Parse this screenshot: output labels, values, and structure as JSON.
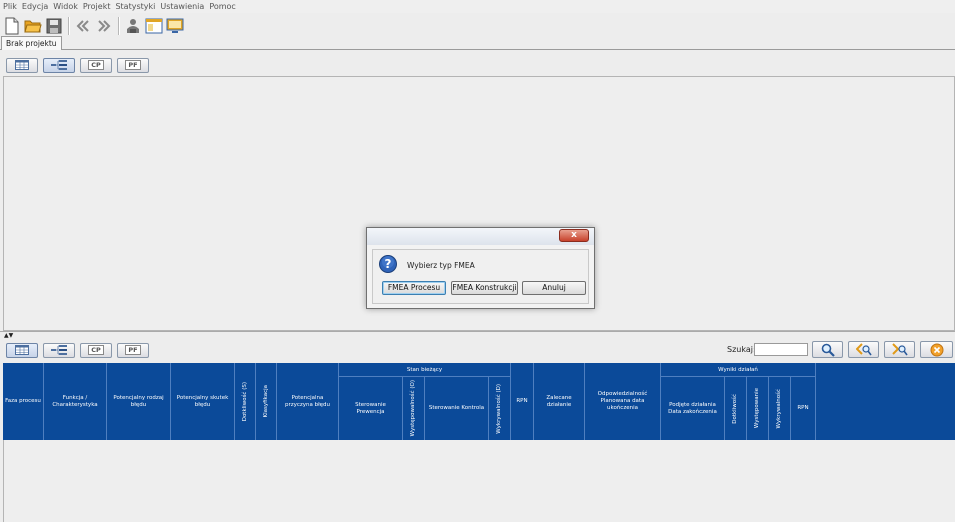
{
  "menu": [
    "Plik",
    "Edycja",
    "Widok",
    "Projekt",
    "Statystyki",
    "Ustawienia",
    "Pomoc"
  ],
  "toolbar": {
    "icons": [
      "new-file-icon",
      "open-folder-icon",
      "save-icon",
      "back-icon",
      "forward-icon",
      "users-icon",
      "window-icon",
      "monitor-icon"
    ]
  },
  "tab": {
    "label": "Brak projektu"
  },
  "view_buttons": {
    "cp": "CP",
    "pf": "PF"
  },
  "search": {
    "label": "Szukaj:",
    "value": ""
  },
  "grid": {
    "columns": {
      "faza": "Faza procesu",
      "funkcja": "Funkcja / Charakterystyka",
      "rodzaj": "Potencjalny rodzaj błędu",
      "skutek": "Potencjalny skutek błędu",
      "dotkliwosc": "Dotkliwość (S)",
      "klasyfikacja": "Klasyfikacja",
      "przyczyna": "Potencjalna przyczyna błędu",
      "stan_group": "Stan bieżący",
      "sterowanie_prewencja": "Sterowanie Prewencja",
      "wystepowalnosc": "Występowalność (O)",
      "sterowanie_kontrola": "Sterowanie Kontrola",
      "wykrywalnosc": "Wykrywalność (D)",
      "rpn": "RPN",
      "zalecane": "Zalecane działanie",
      "odpowiedzialnosc": "Odpowiedzialność Planowana data ukończenia",
      "wyniki_group": "Wyniki działań",
      "podjete": "Podjęte działania Data zakończenia",
      "w_dotkliwosc": "Dotkliwość",
      "w_wystepowanie": "Występowanie",
      "w_wykrywalnosc": "Wykrywalność",
      "w_rpn": "RPN"
    }
  },
  "dialog": {
    "close": "x",
    "message": "Wybierz typ FMEA",
    "buttons": {
      "procesu": "FMEA Procesu",
      "konstrukcji": "FMEA Konstrukcji",
      "anuluj": "Anuluj"
    }
  },
  "colors": {
    "grid_header": "#0b4a99",
    "accent": "#3c7fb1"
  }
}
